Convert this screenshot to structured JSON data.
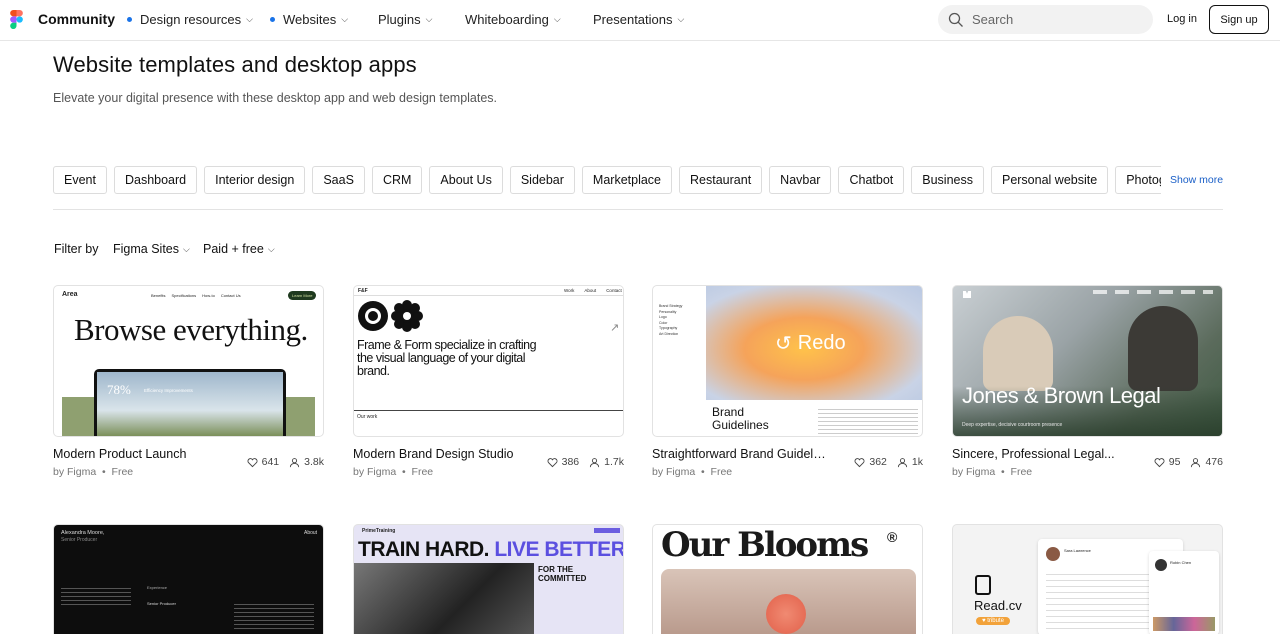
{
  "nav": {
    "brand": "Community",
    "items": [
      {
        "label": "Design resources",
        "dot": true
      },
      {
        "label": "Websites",
        "dot": true
      },
      {
        "label": "Plugins",
        "dot": false
      },
      {
        "label": "Whiteboarding",
        "dot": false
      },
      {
        "label": "Presentations",
        "dot": false
      }
    ],
    "search_placeholder": "Search",
    "login": "Log in",
    "signup": "Sign up"
  },
  "page": {
    "title": "Website templates and desktop apps",
    "subtitle": "Elevate your digital presence with these desktop app and web design templates."
  },
  "chips": [
    "Event",
    "Dashboard",
    "Interior design",
    "SaaS",
    "CRM",
    "About Us",
    "Sidebar",
    "Marketplace",
    "Restaurant",
    "Navbar",
    "Chatbot",
    "Business",
    "Personal website",
    "Photography"
  ],
  "show_more": "Show more",
  "filters": {
    "label": "Filter by",
    "platform": "Figma Sites",
    "price": "Paid + free"
  },
  "cards": [
    {
      "title": "Modern Product Launch",
      "author": "by Figma",
      "price": "Free",
      "likes": "641",
      "users": "3.8k",
      "thumb": {
        "brand": "Area",
        "headline": "Browse everything.",
        "stat": "78%",
        "stat_label": "Efficiency Improvements",
        "cta": "Learn More",
        "nav": [
          "Benefits",
          "Specifications",
          "How-to",
          "Contact Us"
        ]
      }
    },
    {
      "title": "Modern Brand Design Studio",
      "author": "by Figma",
      "price": "Free",
      "likes": "386",
      "users": "1.7k",
      "thumb": {
        "brand": "F&F",
        "nav": [
          "Work",
          "About",
          "Contact"
        ],
        "headline": "Frame & Form specialize in crafting the visual language of your digital brand.",
        "footer": "Our work"
      }
    },
    {
      "title": "Straightforward Brand Guidelines",
      "author": "by Figma",
      "price": "Free",
      "likes": "362",
      "users": "1k",
      "thumb": {
        "brand": "Redo",
        "headline": "Brand Guidelines",
        "menu": [
          "Brand Strategy",
          "Personality",
          "Logo",
          "Color",
          "Typography",
          "Art Direction"
        ]
      }
    },
    {
      "title": "Sincere, Professional Legal...",
      "author": "by Figma",
      "price": "Free",
      "likes": "95",
      "users": "476",
      "thumb": {
        "headline": "Jones & Brown Legal",
        "tagline": "Deep expertise, decisive courtroom presence"
      }
    }
  ],
  "cards_row2": [
    {
      "thumb": {
        "name": "Alexandra Moore,",
        "role": "Senior Producer",
        "nav": "About",
        "section": "Experience",
        "job": "Senior Producer"
      }
    },
    {
      "thumb": {
        "brand": "PrimeTraining",
        "headline_a": "TRAIN HARD.",
        "headline_b": "LIVE BETTER",
        "side": "FOR THE COMMITTED"
      }
    },
    {
      "thumb": {
        "headline": "Our Blooms"
      }
    },
    {
      "thumb": {
        "brand": "Read.cv",
        "badge": "tribute",
        "person_a": "Sara Lawrence",
        "person_b": "Robin Chen"
      }
    }
  ],
  "colors": {
    "accent_dot": "#1a73e8",
    "show_more": "#1a5fc7",
    "legal_green": "#4a6a4e",
    "redo_orange": "#f2a65a"
  }
}
